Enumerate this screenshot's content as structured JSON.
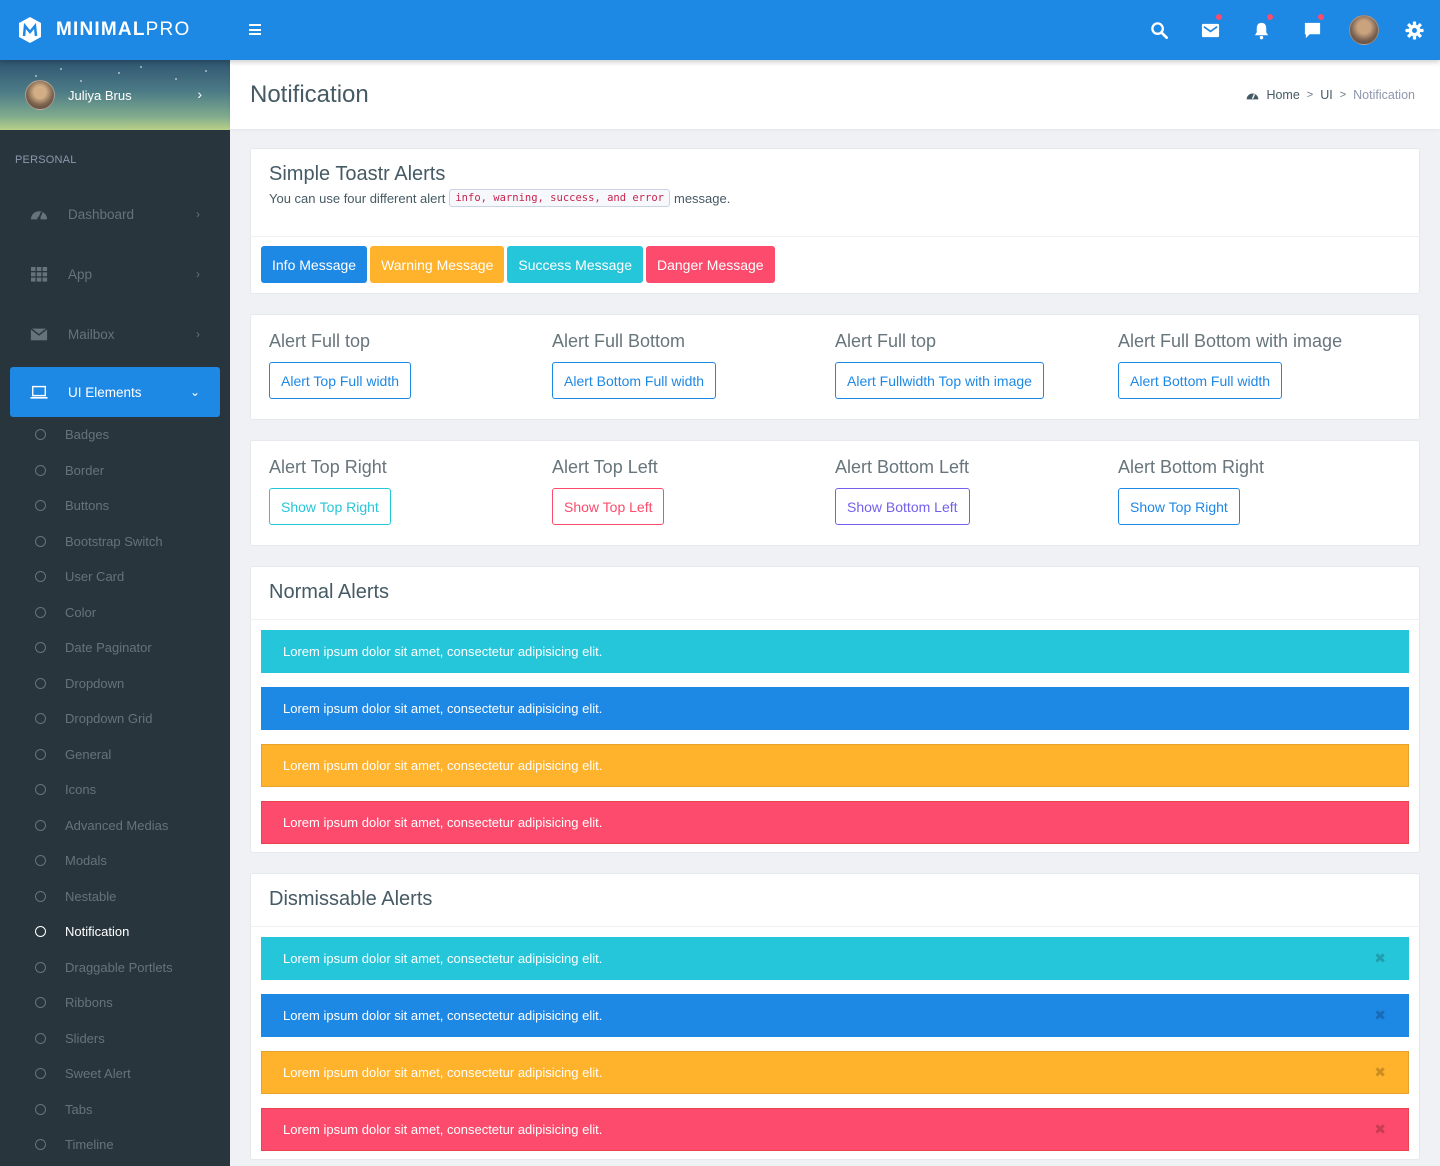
{
  "brand": {
    "bold": "MINIMAL",
    "light": "PRO"
  },
  "header": {
    "icons": [
      {
        "name": "search-icon",
        "badge": false
      },
      {
        "name": "mail-icon",
        "badge": true
      },
      {
        "name": "bell-icon",
        "badge": true
      },
      {
        "name": "chat-icon",
        "badge": true
      },
      {
        "name": "user-avatar",
        "badge": false
      },
      {
        "name": "gear-icon",
        "badge": false
      }
    ]
  },
  "sidebar": {
    "user_name": "Juliya Brus",
    "section": "PERSONAL",
    "items": [
      {
        "label": "Dashboard",
        "icon": "dashboard-icon"
      },
      {
        "label": "App",
        "icon": "grid-icon"
      },
      {
        "label": "Mailbox",
        "icon": "mail-icon"
      },
      {
        "label": "UI Elements",
        "icon": "laptop-icon",
        "active": true
      }
    ],
    "sub_items": [
      "Badges",
      "Border",
      "Buttons",
      "Bootstrap Switch",
      "User Card",
      "Color",
      "Date Paginator",
      "Dropdown",
      "Dropdown Grid",
      "General",
      "Icons",
      "Advanced Medias",
      "Modals",
      "Nestable",
      "Notification",
      "Draggable Portlets",
      "Ribbons",
      "Sliders",
      "Sweet Alert",
      "Tabs",
      "Timeline"
    ],
    "current_sub": "Notification"
  },
  "page": {
    "title": "Notification",
    "breadcrumb": [
      "Home",
      "UI",
      "Notification"
    ]
  },
  "toastr": {
    "title": "Simple Toastr Alerts",
    "desc_before": "You can use four different alert",
    "code": "info, warning, success, and error",
    "desc_after": "message.",
    "buttons": [
      {
        "label": "Info Message",
        "color": "#1e88e5"
      },
      {
        "label": "Warning Message",
        "color": "#ffb22b"
      },
      {
        "label": "Success Message",
        "color": "#26c6da"
      },
      {
        "label": "Danger Message",
        "color": "#fc4b6c"
      }
    ]
  },
  "fullwidth": [
    {
      "heading": "Alert Full top",
      "button": "Alert Top Full width",
      "color": "#1e88e5"
    },
    {
      "heading": "Alert Full Bottom",
      "button": "Alert Bottom Full width",
      "color": "#1e88e5"
    },
    {
      "heading": "Alert Full top",
      "button": "Alert Fullwidth Top with image",
      "color": "#1e88e5"
    },
    {
      "heading": "Alert Full Bottom with image",
      "button": "Alert Bottom Full width",
      "color": "#1e88e5"
    }
  ],
  "positions": [
    {
      "heading": "Alert Top Right",
      "button": "Show Top Right",
      "color": "#26c6da"
    },
    {
      "heading": "Alert Top Left",
      "button": "Show Top Left",
      "color": "#fc4b6c"
    },
    {
      "heading": "Alert Bottom Left",
      "button": "Show Bottom Left",
      "color": "#7460ee"
    },
    {
      "heading": "Alert Bottom Right",
      "button": "Show Top Right",
      "color": "#1e88e5"
    }
  ],
  "normal_alerts": {
    "title": "Normal Alerts",
    "items": [
      {
        "text": "Lorem ipsum dolor sit amet, consectetur adipisicing elit.",
        "color": "#26c6da",
        "border": "#26c6da"
      },
      {
        "text": "Lorem ipsum dolor sit amet, consectetur adipisicing elit.",
        "color": "#1e88e5",
        "border": "#1e88e5"
      },
      {
        "text": "Lorem ipsum dolor sit amet, consectetur adipisicing elit.",
        "color": "#ffb22b",
        "border": "#e8a229"
      },
      {
        "text": "Lorem ipsum dolor sit amet, consectetur adipisicing elit.",
        "color": "#fc4b6c",
        "border": "#e8434f"
      }
    ]
  },
  "dismissable_alerts": {
    "title": "Dismissable Alerts",
    "close_glyph": "✖",
    "items": [
      {
        "text": "Lorem ipsum dolor sit amet, consectetur adipisicing elit.",
        "color": "#26c6da",
        "border": "#26c6da"
      },
      {
        "text": "Lorem ipsum dolor sit amet, consectetur adipisicing elit.",
        "color": "#1e88e5",
        "border": "#1e88e5"
      },
      {
        "text": "Lorem ipsum dolor sit amet, consectetur adipisicing elit.",
        "color": "#ffb22b",
        "border": "#e8a229"
      },
      {
        "text": "Lorem ipsum dolor sit amet, consectetur adipisicing elit.",
        "color": "#fc4b6c",
        "border": "#e8434f"
      }
    ]
  }
}
